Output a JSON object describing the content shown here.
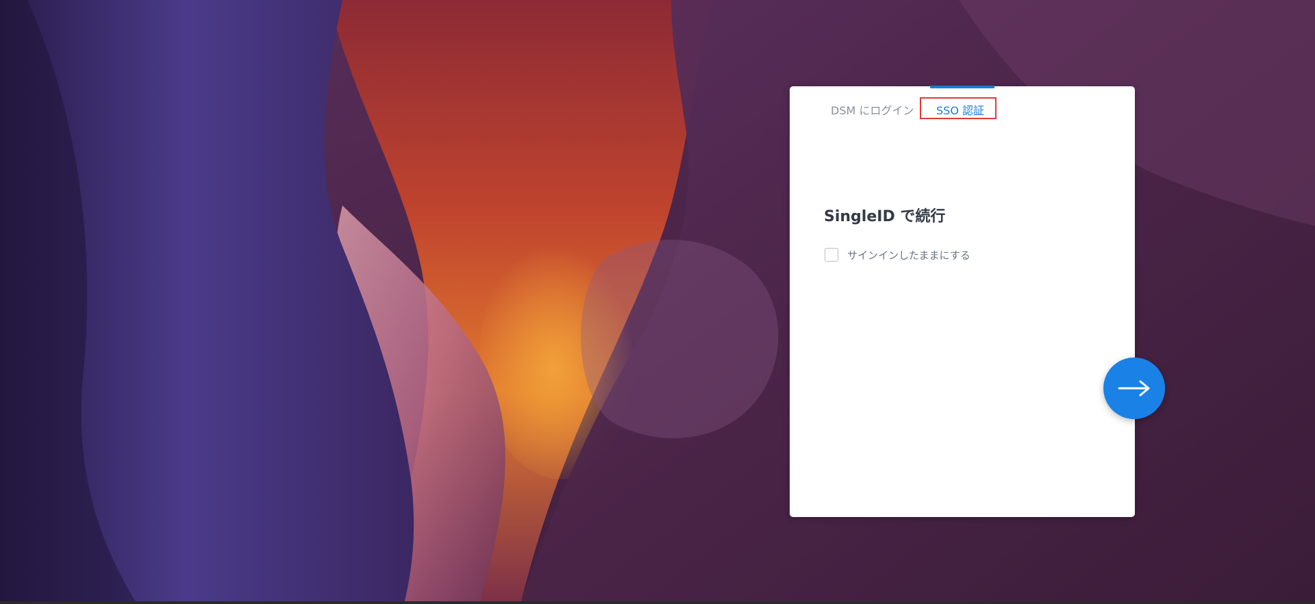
{
  "tabs": {
    "dsm_login": "DSM にログイン",
    "sso": "SSO 認証"
  },
  "main": {
    "heading": "SingleID で続行",
    "remember_me": "サインインしたままにする",
    "remember_checked": false
  },
  "icons": {
    "next": "arrow-right-icon"
  },
  "colors": {
    "accent": "#1a7ad6",
    "next_button": "#1a82e6",
    "highlight": "#e53935",
    "card": "#ffffff"
  }
}
